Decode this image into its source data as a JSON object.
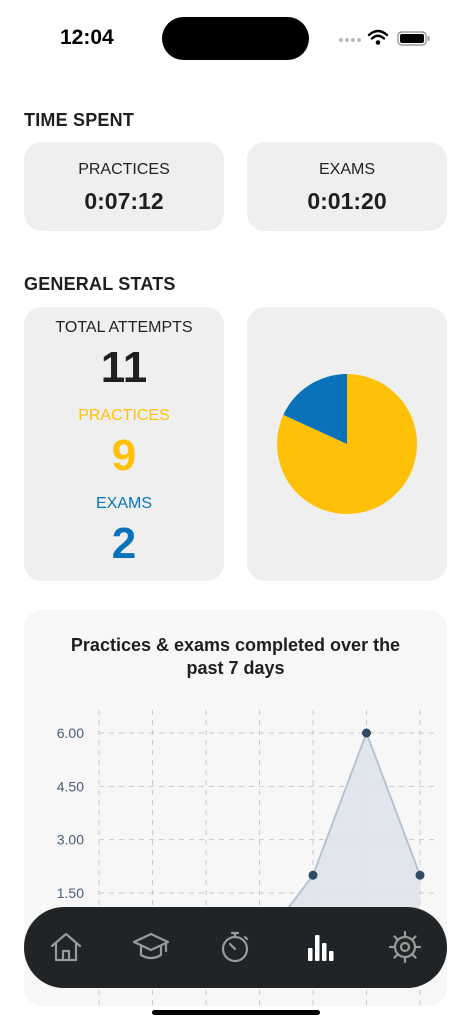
{
  "status_bar": {
    "time": "12:04"
  },
  "time_spent": {
    "title": "TIME SPENT",
    "practices_label": "PRACTICES",
    "practices_value": "0:07:12",
    "exams_label": "EXAMS",
    "exams_value": "0:01:20"
  },
  "general_stats": {
    "title": "GENERAL STATS",
    "total_label": "TOTAL ATTEMPTS",
    "total_value": "11",
    "practices_label": "PRACTICES",
    "practices_value": "9",
    "exams_label": "EXAMS",
    "exams_value": "2"
  },
  "colors": {
    "practices": "#FFC107",
    "exams": "#0A72BA",
    "tab_bar": "#212426",
    "card": "#EFEFEF"
  },
  "pie_chart": {
    "type": "pie",
    "slices": [
      {
        "value": 9,
        "color": "#FFC107"
      },
      {
        "value": 2,
        "color": "#0A72BA"
      }
    ]
  },
  "chart_data": {
    "type": "area",
    "title": "Practices & exams completed over the past 7 days",
    "y_ticks": [
      "6.00",
      "4.50",
      "3.00",
      "1.50"
    ],
    "ylim": [
      0,
      6
    ],
    "x": [
      1,
      2,
      3,
      4,
      5,
      6,
      7
    ],
    "values": [
      0,
      0,
      0,
      0,
      2,
      6,
      2
    ],
    "grid": true
  },
  "tab_bar": {
    "items": [
      {
        "icon": "home-icon"
      },
      {
        "icon": "graduation-cap-icon"
      },
      {
        "icon": "stopwatch-icon"
      },
      {
        "icon": "bar-chart-icon",
        "active": true
      },
      {
        "icon": "gear-icon"
      }
    ]
  }
}
